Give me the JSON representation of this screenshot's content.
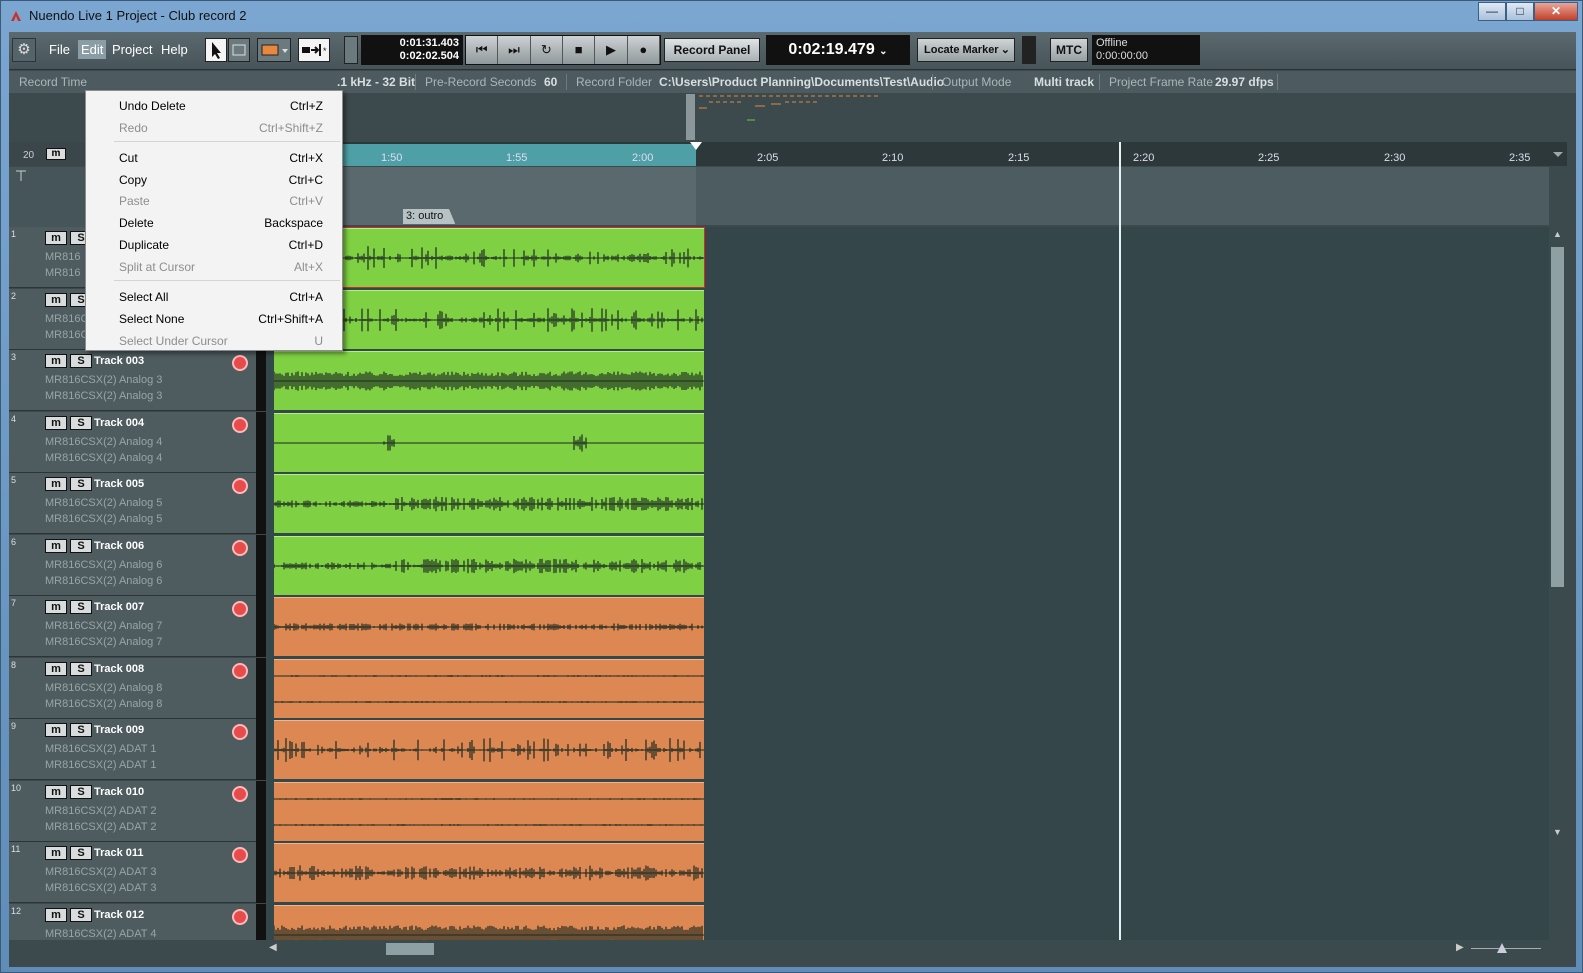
{
  "window": {
    "title": "Nuendo Live 1 Project - Club record 2",
    "minimize": "—",
    "maximize": "□",
    "close": "✕"
  },
  "menubar": {
    "items": [
      "File",
      "Edit",
      "Project",
      "Help"
    ],
    "active": "Edit"
  },
  "toolbar": {
    "time_top": "0:01:31.403",
    "time_bottom": "0:02:02.504",
    "transport": [
      "⏮",
      "⏭",
      "↻",
      "■",
      "▶",
      "●"
    ],
    "record_panel": "Record Panel",
    "main_time": "0:02:19.479",
    "locate_marker": "Locate Marker",
    "mtc": "MTC",
    "offline_status": "Offline",
    "offline_time": "0:00:00:00"
  },
  "infobar": {
    "record_time_label": "Record Time",
    "format_value": ".1 kHz - 32 Bit",
    "pre_record_label": "Pre-Record Seconds",
    "pre_record_value": "60",
    "record_folder_label": "Record Folder",
    "record_folder_value": "C:\\Users\\Product Planning\\Documents\\Test\\Audio",
    "output_mode_label": "Output Mode",
    "output_mode_value": "Multi track",
    "frame_rate_label": "Project Frame Rate",
    "frame_rate_value": "29.97 dfps"
  },
  "ruler": {
    "zoom_label": "20",
    "ticks": [
      "1:50",
      "1:55",
      "2:00",
      "2:05",
      "2:10",
      "2:15",
      "2:20",
      "2:25",
      "2:30",
      "2:35"
    ]
  },
  "marker": {
    "label": "3: outro"
  },
  "edit_menu": {
    "items": [
      {
        "label": "Undo Delete",
        "shortcut": "Ctrl+Z",
        "enabled": true
      },
      {
        "label": "Redo",
        "shortcut": "Ctrl+Shift+Z",
        "enabled": false
      },
      {
        "label": "Cut",
        "shortcut": "Ctrl+X",
        "enabled": true
      },
      {
        "label": "Copy",
        "shortcut": "Ctrl+C",
        "enabled": true
      },
      {
        "label": "Paste",
        "shortcut": "Ctrl+V",
        "enabled": false
      },
      {
        "label": "Delete",
        "shortcut": "Backspace",
        "enabled": true
      },
      {
        "label": "Duplicate",
        "shortcut": "Ctrl+D",
        "enabled": true
      },
      {
        "label": "Split at Cursor",
        "shortcut": "Alt+X",
        "enabled": false
      },
      {
        "label": "Select All",
        "shortcut": "Ctrl+A",
        "enabled": true
      },
      {
        "label": "Select None",
        "shortcut": "Ctrl+Shift+A",
        "enabled": true
      },
      {
        "label": "Select Under Cursor",
        "shortcut": "U",
        "enabled": false
      }
    ]
  },
  "tracks": [
    {
      "num": "1",
      "name": "",
      "input1": "MR816",
      "input2": "MR816",
      "color": "green"
    },
    {
      "num": "2",
      "name": "",
      "input1": "MR816CSX(2) Analog 2",
      "input2": "MR816CSX(2) Analog 2",
      "color": "green"
    },
    {
      "num": "3",
      "name": "Track 003",
      "input1": "MR816CSX(2) Analog 3",
      "input2": "MR816CSX(2) Analog 3",
      "color": "green"
    },
    {
      "num": "4",
      "name": "Track 004",
      "input1": "MR816CSX(2) Analog 4",
      "input2": "MR816CSX(2) Analog 4",
      "color": "green"
    },
    {
      "num": "5",
      "name": "Track 005",
      "input1": "MR816CSX(2) Analog 5",
      "input2": "MR816CSX(2) Analog 5",
      "color": "green"
    },
    {
      "num": "6",
      "name": "Track 006",
      "input1": "MR816CSX(2) Analog 6",
      "input2": "MR816CSX(2) Analog 6",
      "color": "green"
    },
    {
      "num": "7",
      "name": "Track 007",
      "input1": "MR816CSX(2) Analog 7",
      "input2": "MR816CSX(2) Analog 7",
      "color": "orange"
    },
    {
      "num": "8",
      "name": "Track 008",
      "input1": "MR816CSX(2) Analog 8",
      "input2": "MR816CSX(2) Analog 8",
      "color": "orange"
    },
    {
      "num": "9",
      "name": "Track 009",
      "input1": "MR816CSX(2) ADAT 1",
      "input2": "MR816CSX(2) ADAT 1",
      "color": "orange"
    },
    {
      "num": "10",
      "name": "Track 010",
      "input1": "MR816CSX(2) ADAT 2",
      "input2": "MR816CSX(2) ADAT 2",
      "color": "orange"
    },
    {
      "num": "11",
      "name": "Track 011",
      "input1": "MR816CSX(2) ADAT 3",
      "input2": "MR816CSX(2) ADAT 3",
      "color": "orange"
    },
    {
      "num": "12",
      "name": "Track 012",
      "input1": "MR816CSX(2) ADAT 4",
      "input2": "",
      "color": "orange"
    }
  ],
  "track_buttons": {
    "mute": "m",
    "solo": "S"
  },
  "colors": {
    "clip_green": "#7fd043",
    "clip_orange": "#dd8752",
    "record_red": "#e84b4b",
    "ruler_played": "#4fa0a6"
  }
}
